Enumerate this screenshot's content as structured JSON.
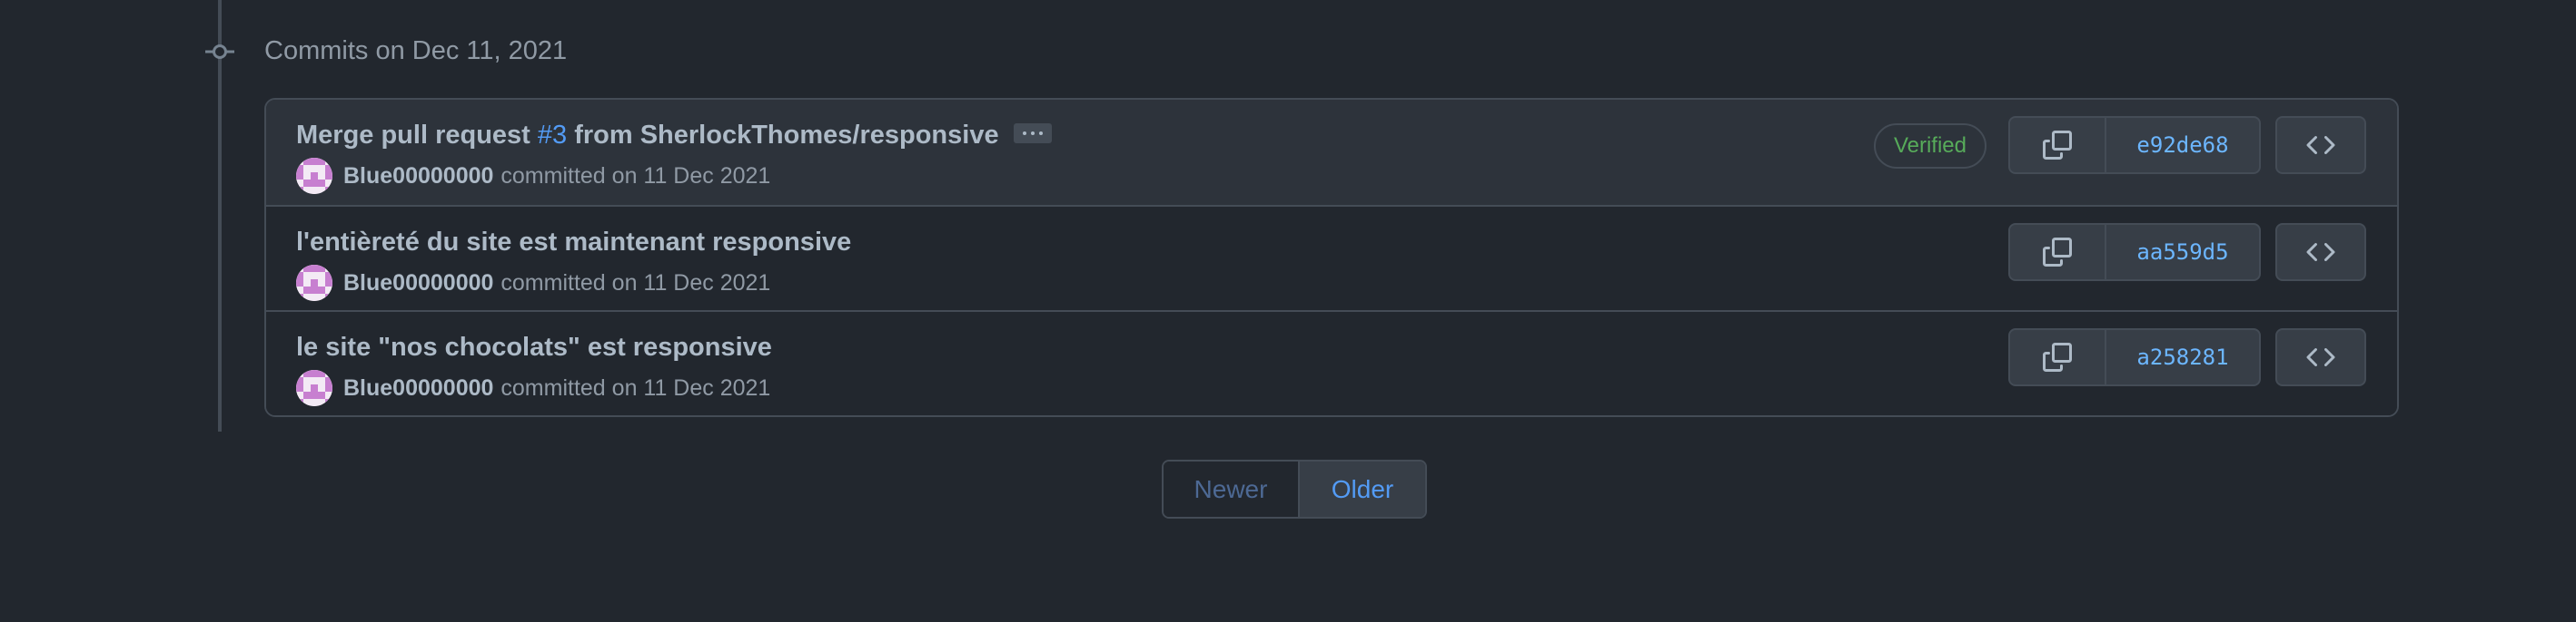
{
  "group": {
    "title": "Commits on Dec 11, 2021"
  },
  "commits": [
    {
      "message_prefix": "Merge pull request ",
      "pr_link": "#3",
      "message_suffix": " from SherlockThomes/responsive",
      "author": "Blue00000000",
      "committed": "committed on 11 Dec 2021",
      "verified": "Verified",
      "sha": "e92de68"
    },
    {
      "message": "l'entièreté du site est maintenant responsive",
      "author": "Blue00000000",
      "committed": "committed on 11 Dec 2021",
      "sha": "aa559d5"
    },
    {
      "message": "le site \"nos chocolats\" est responsive",
      "author": "Blue00000000",
      "committed": "committed on 11 Dec 2021",
      "sha": "a258281"
    }
  ],
  "pagination": {
    "newer": "Newer",
    "older": "Older"
  },
  "icons": {
    "timeline": "git-commit-icon",
    "copy": "copy-icon",
    "browse": "code-icon",
    "more": "kebab-horizontal-icon"
  },
  "colors": {
    "background": "#22272e",
    "row_highlight": "#2d333b",
    "border": "#444c56",
    "text": "#adbac7",
    "muted": "#909aa5",
    "link": "#539bf5",
    "verified": "#57ab5a"
  }
}
